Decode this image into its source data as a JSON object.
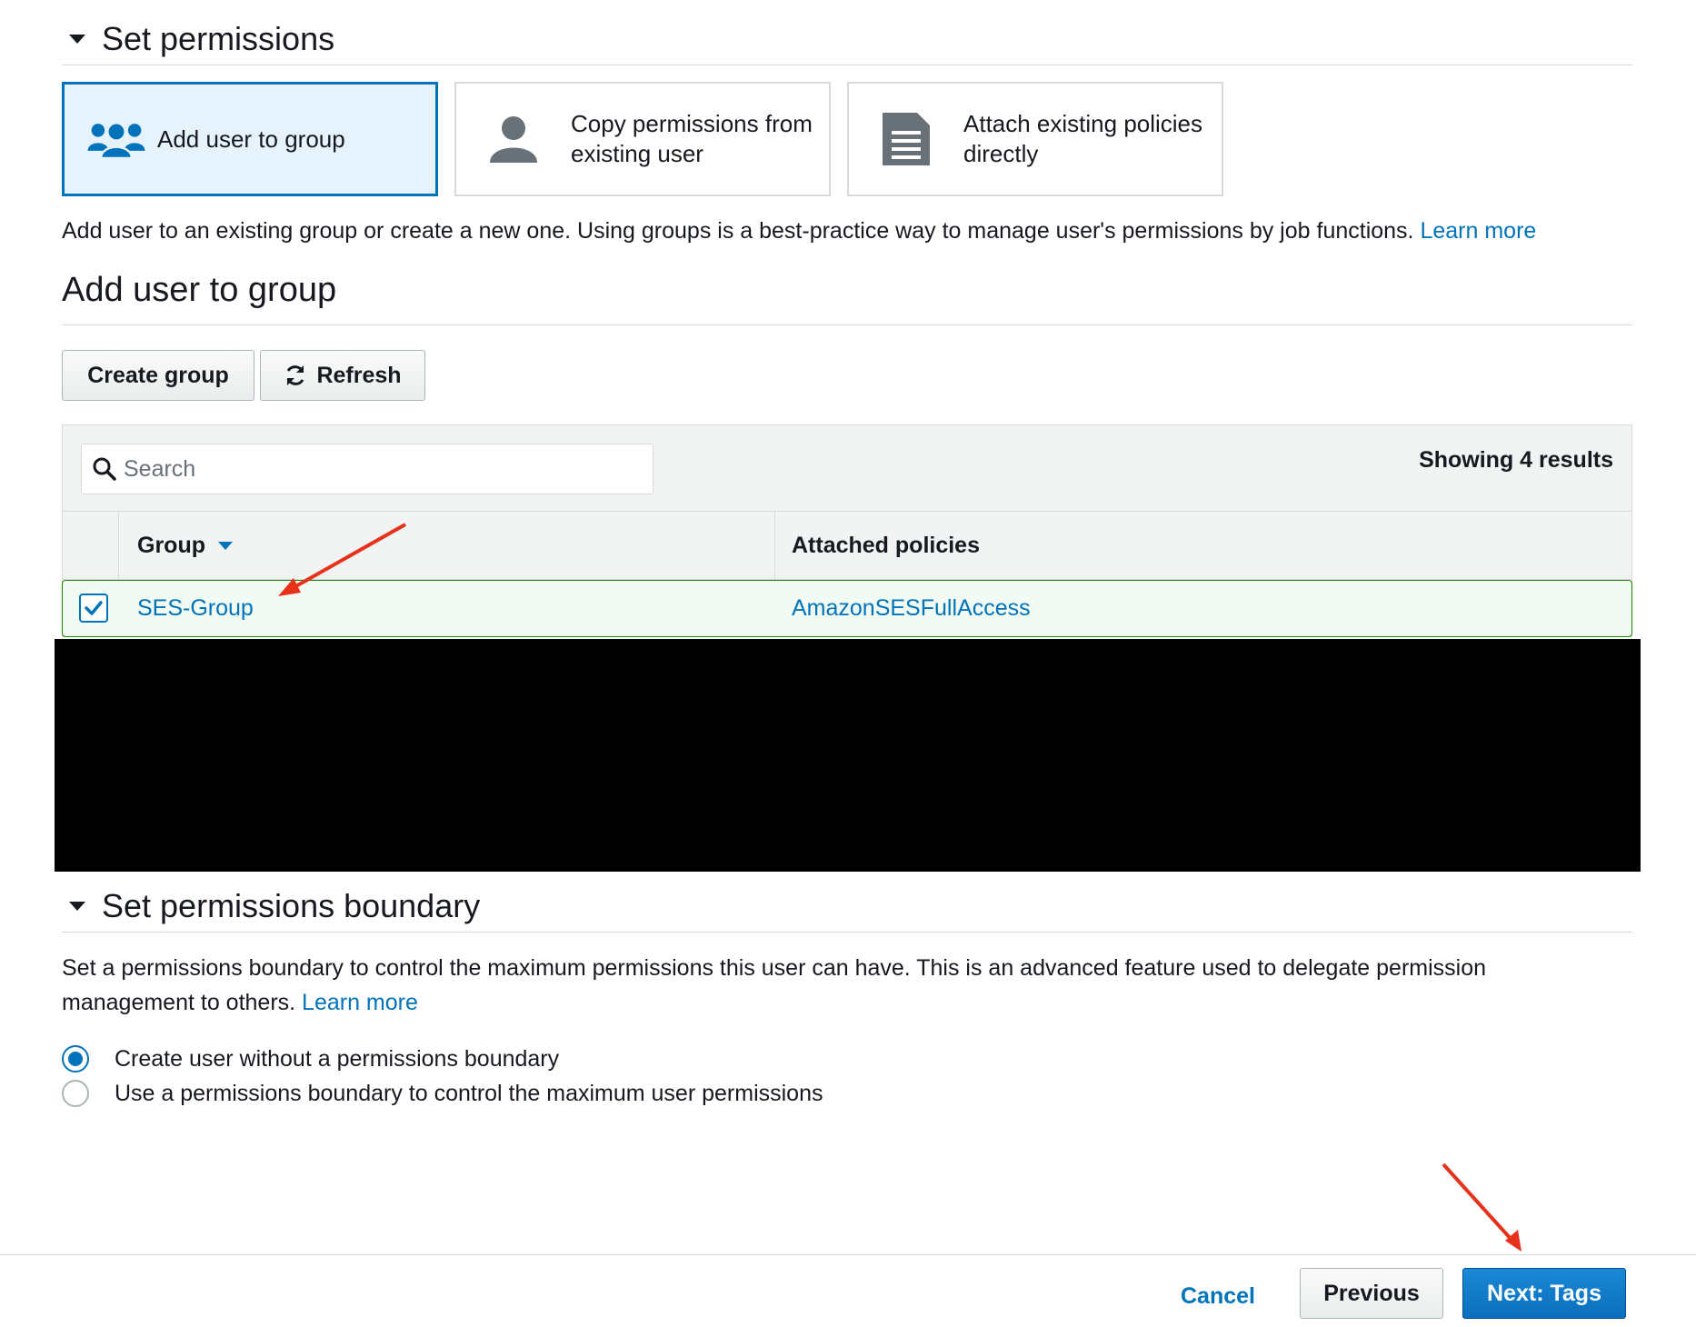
{
  "permissions_section": {
    "title": "Set permissions",
    "options": [
      {
        "label": "Add user to group",
        "icon": "users-group-icon",
        "selected": true
      },
      {
        "label": "Copy permissions from existing user",
        "icon": "user-icon",
        "selected": false
      },
      {
        "label": "Attach existing policies directly",
        "icon": "document-icon",
        "selected": false
      }
    ],
    "description": "Add user to an existing group or create a new one. Using groups is a best-practice way to manage user's permissions by job functions.",
    "learn_more": "Learn more"
  },
  "group_section": {
    "title": "Add user to group",
    "create_group_label": "Create group",
    "refresh_label": "Refresh",
    "search_placeholder": "Search",
    "showing_results": "Showing 4 results",
    "columns": [
      "Group",
      "Attached policies"
    ],
    "rows": [
      {
        "group": "SES-Group",
        "policy": "AmazonSESFullAccess",
        "checked": true
      }
    ]
  },
  "boundary_section": {
    "title": "Set permissions boundary",
    "description": "Set a permissions boundary to control the maximum permissions this user can have. This is an advanced feature used to delegate permission management to others.",
    "learn_more": "Learn more",
    "radio_options": [
      {
        "label": "Create user without a permissions boundary",
        "checked": true
      },
      {
        "label": "Use a permissions boundary to control the maximum user permissions",
        "checked": false
      }
    ]
  },
  "footer": {
    "cancel_label": "Cancel",
    "previous_label": "Previous",
    "next_label": "Next: Tags"
  },
  "colors": {
    "accent": "#0073bb",
    "selected_row_border": "#1d8102",
    "annotation_arrow": "#e8311a"
  }
}
